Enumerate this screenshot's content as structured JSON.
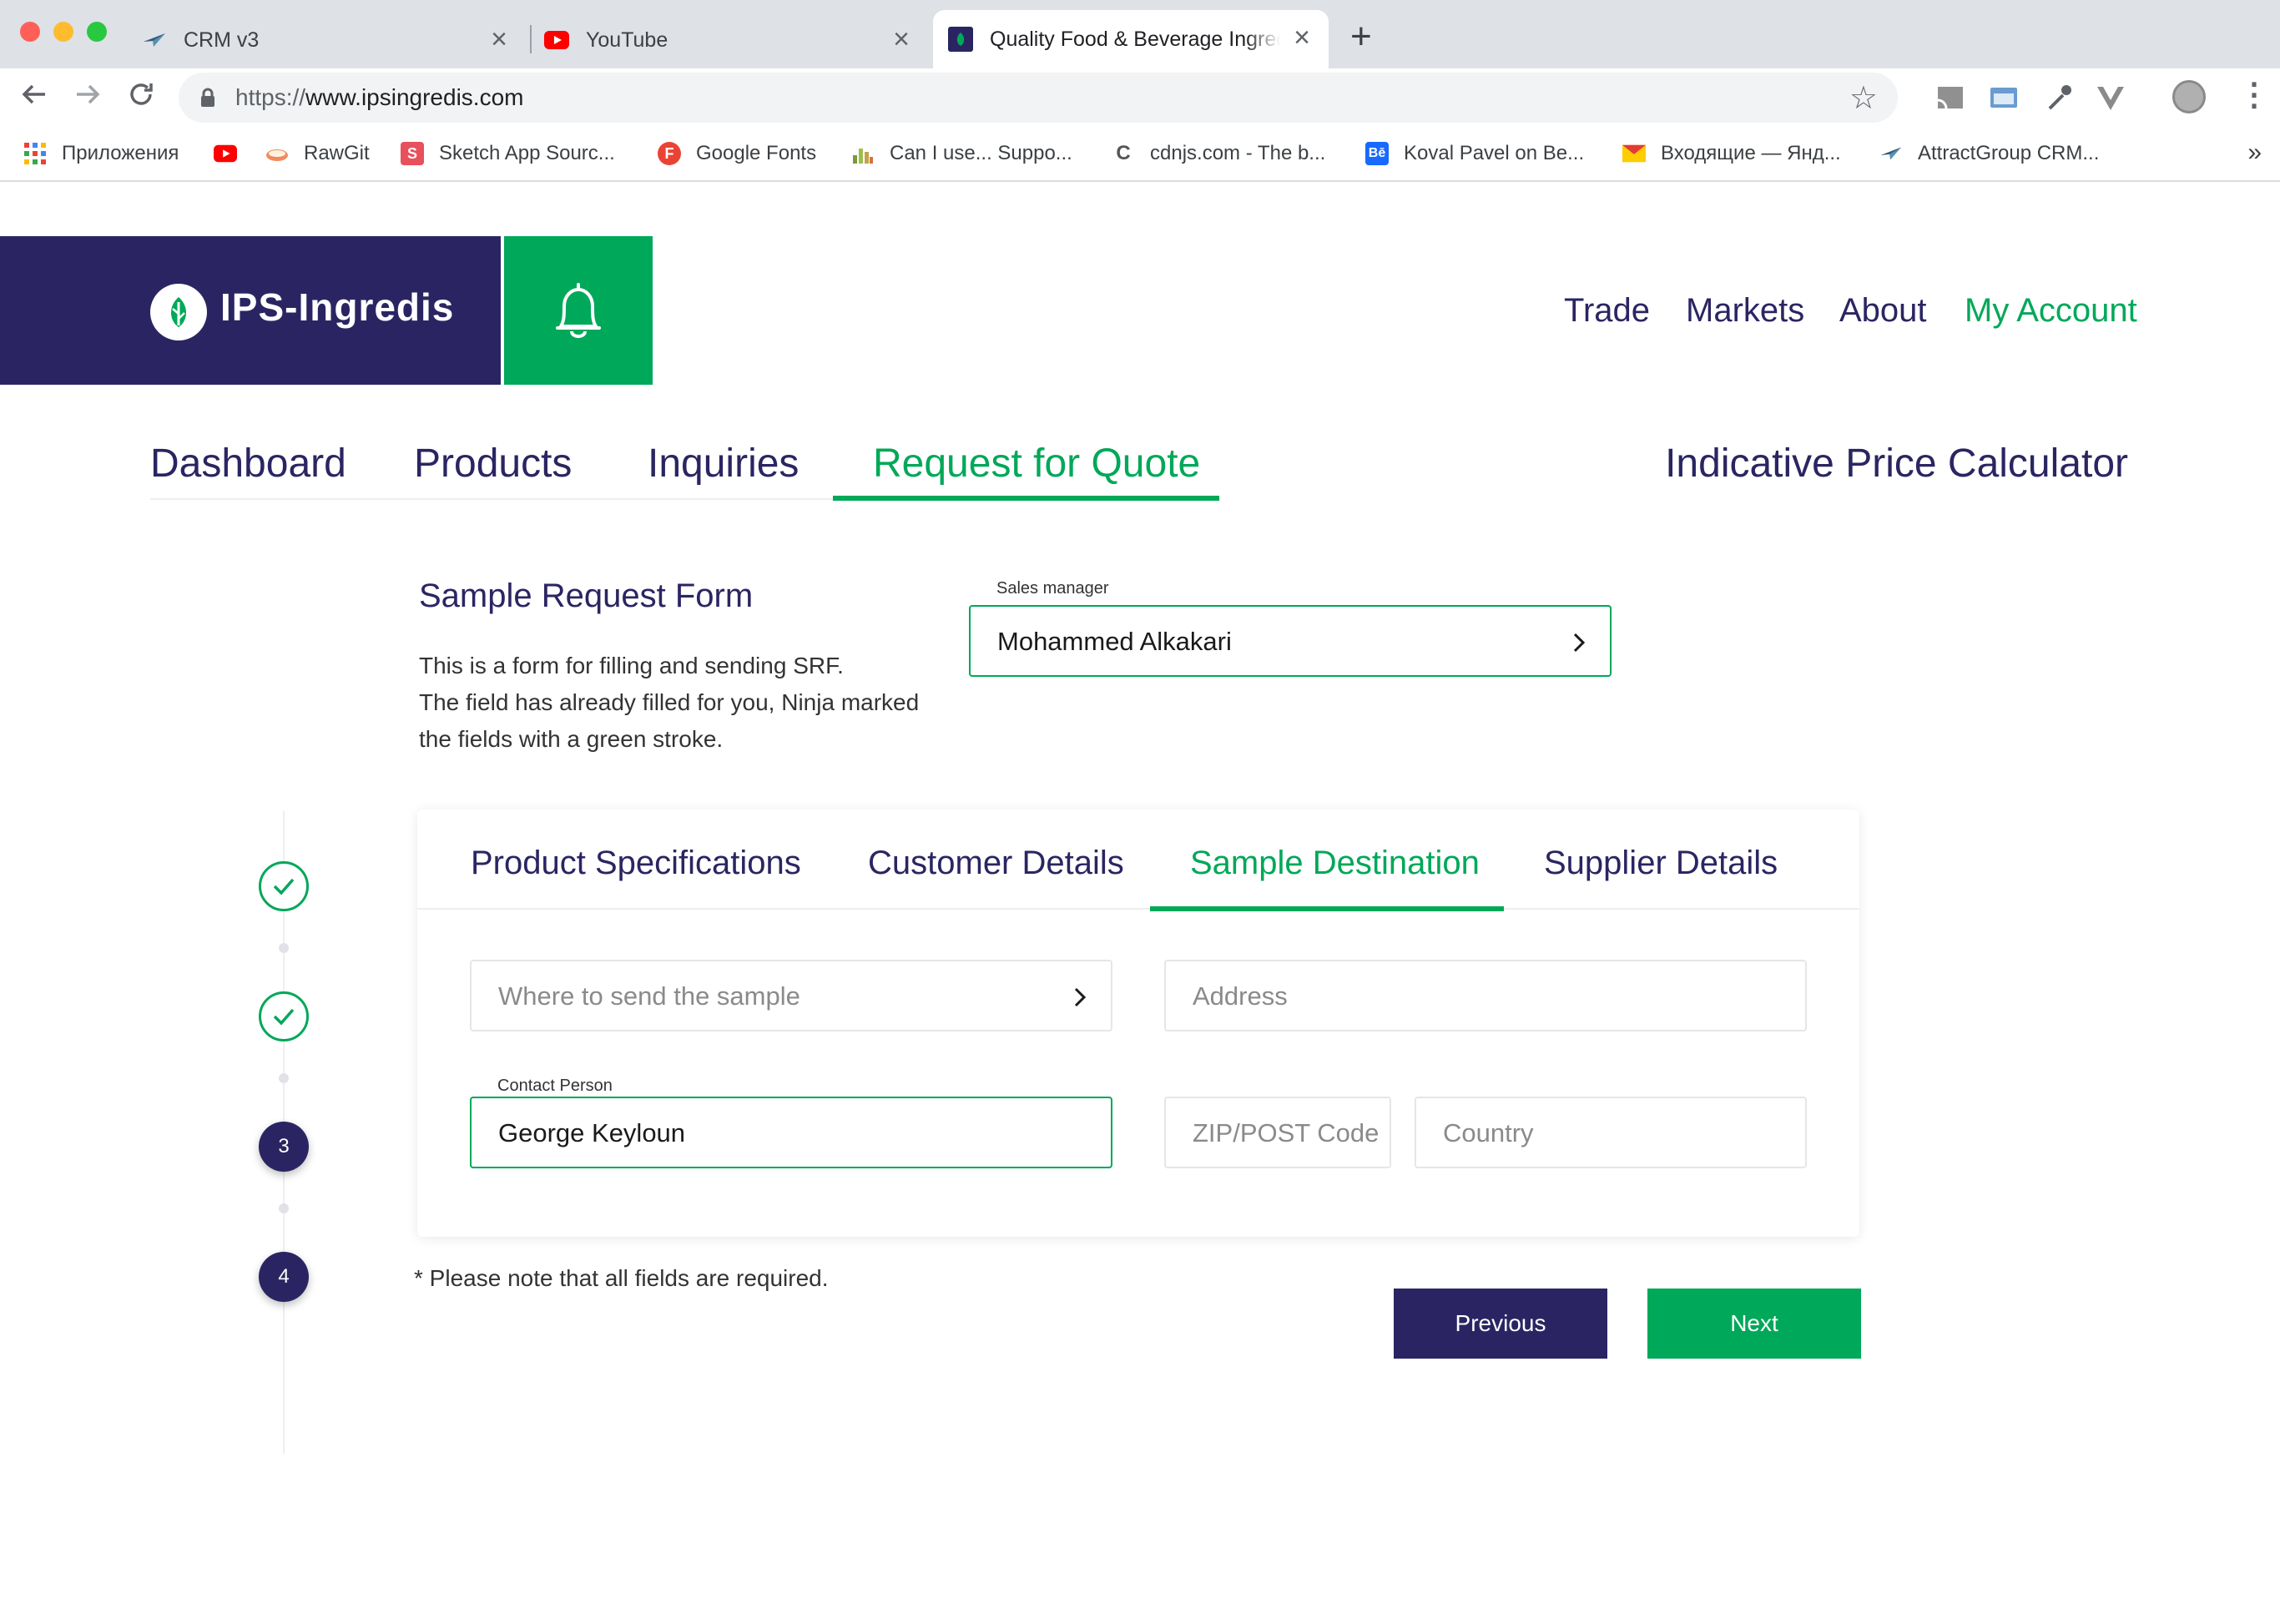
{
  "browser": {
    "tabs": [
      {
        "title": "CRM v3",
        "close": "×"
      },
      {
        "title": "YouTube",
        "close": "×"
      },
      {
        "title": "Quality Food & Beverage Ingredients",
        "close": "×"
      }
    ],
    "new_tab": "+",
    "url_scheme": "https://",
    "url_host": "www.ipsingredis.com",
    "bookmarks": [
      {
        "label": "Приложения",
        "icon": "apps-grid-icon"
      },
      {
        "label": "",
        "icon": "youtube-icon"
      },
      {
        "label": "RawGit",
        "icon": "rawgit-icon"
      },
      {
        "label": "Sketch App Sourc...",
        "icon": "sketch-icon"
      },
      {
        "label": "Google Fonts",
        "icon": "google-fonts-icon"
      },
      {
        "label": "Can I use... Suppo...",
        "icon": "caniuse-icon"
      },
      {
        "label": "cdnjs.com - The b...",
        "icon": "cdnjs-icon"
      },
      {
        "label": "Koval Pavel on Be...",
        "icon": "behance-icon"
      },
      {
        "label": "Входящие — Янд...",
        "icon": "mail-icon"
      },
      {
        "label": "AttractGroup CRM...",
        "icon": "crm-icon"
      }
    ],
    "bookmarks_more": "»"
  },
  "site": {
    "brand_name": "IPS-Ingredis",
    "top_nav": [
      "Trade",
      "Markets",
      "About",
      "My Account"
    ],
    "top_nav_active": "My Account",
    "sub_nav": [
      "Dashboard",
      "Products",
      "Inquiries",
      "Request for Quote"
    ],
    "sub_nav_active": "Request for Quote",
    "calculator_link": "Indicative Price Calculator"
  },
  "form": {
    "title": "Sample Request Form",
    "description_1": "This is a form for filling and sending SRF.",
    "description_2": "The field has already filled for you, Ninja marked",
    "description_3": "the fields with a green stroke.",
    "sales_manager_label": "Sales manager",
    "sales_manager_value": "Mohammed Alkakari",
    "steps": [
      {
        "label": "",
        "status": "done"
      },
      {
        "label": "",
        "status": "done"
      },
      {
        "label": "3",
        "status": "todo"
      },
      {
        "label": "4",
        "status": "todo"
      }
    ],
    "tabs": [
      "Product Specifications",
      "Customer Details",
      "Sample Destination",
      "Supplier Details"
    ],
    "active_tab": "Sample Destination",
    "fields": {
      "send_to_placeholder": "Where to send the sample",
      "address_placeholder": "Address",
      "contact_label": "Contact Person",
      "contact_value": "George Keyloun",
      "zip_placeholder": "ZIP/POST Code",
      "country_placeholder": "Country"
    },
    "note": "* Please note that all fields are required.",
    "previous_label": "Previous",
    "next_label": "Next"
  },
  "colors": {
    "navy": "#2a2562",
    "green": "#00a859"
  }
}
